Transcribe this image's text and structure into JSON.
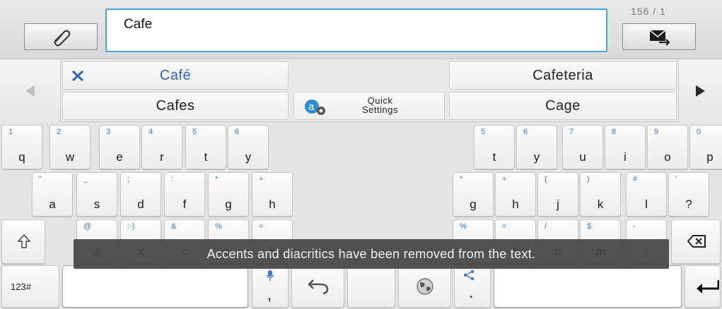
{
  "composer": {
    "text": "Cafe",
    "char_counter": "156 / 1"
  },
  "icons": {
    "attach": "paperclip-icon",
    "send": "send-message-icon",
    "close": "close-icon",
    "quick_settings": "quick-settings-icon",
    "shift": "shift-icon",
    "backspace": "backspace-icon",
    "mic": "microphone-icon",
    "undo": "undo-icon",
    "language": "globe-icon",
    "share": "share-icon",
    "enter": "enter-icon",
    "left": "arrow-left-icon",
    "right": "arrow-right-icon"
  },
  "suggestions": {
    "primary": "Café",
    "secondary": "Cafes",
    "right_top": "Cafeteria",
    "right_bottom": "Cage",
    "quick_settings_line1": "Quick",
    "quick_settings_line2": "Settings"
  },
  "keys": {
    "row1_left": [
      {
        "sec": "1",
        "pri": "q"
      },
      {
        "sec": "2",
        "pri": "w"
      },
      {
        "sec": "3",
        "pri": "e"
      },
      {
        "sec": "4",
        "pri": "r"
      },
      {
        "sec": "5",
        "pri": "t"
      },
      {
        "sec": "6",
        "pri": "y"
      }
    ],
    "row1_right": [
      {
        "sec": "5",
        "pri": "t"
      },
      {
        "sec": "6",
        "pri": "y"
      },
      {
        "sec": "7",
        "pri": "u"
      },
      {
        "sec": "8",
        "pri": "i"
      },
      {
        "sec": "9",
        "pri": "o"
      },
      {
        "sec": "0",
        "pri": "p"
      }
    ],
    "row2_left": [
      {
        "sec": "\"",
        "pri": "a"
      },
      {
        "sec": "_",
        "pri": "s"
      },
      {
        "sec": ";",
        "pri": "d"
      },
      {
        "sec": ":",
        "pri": "f"
      },
      {
        "sec": "*",
        "pri": "g"
      },
      {
        "sec": "+",
        "pri": "h"
      }
    ],
    "row2_right": [
      {
        "sec": "*",
        "pri": "g"
      },
      {
        "sec": "+",
        "pri": "h"
      },
      {
        "sec": "(",
        "pri": "j"
      },
      {
        "sec": ")",
        "pri": "k"
      },
      {
        "sec": "#",
        "pri": "l"
      },
      {
        "sec": "'",
        "pri": "?"
      }
    ],
    "row3_left": [
      {
        "sec": "@",
        "pri": "z"
      },
      {
        "sec": ":-)",
        "pri": "x"
      },
      {
        "sec": "&",
        "pri": "c"
      },
      {
        "sec": "%",
        "pri": "v"
      },
      {
        "sec": "=",
        "pri": "b"
      }
    ],
    "row3_right": [
      {
        "sec": "%",
        "pri": "v"
      },
      {
        "sec": "=",
        "pri": "b"
      },
      {
        "sec": "/",
        "pri": "n"
      },
      {
        "sec": "$",
        "pri": "m"
      },
      {
        "sec": "-",
        "pri": "!"
      }
    ],
    "mode_switch": "123#",
    "comma": ",",
    "period": "."
  },
  "toast": {
    "message": "Accents and diacritics have been removed from the text."
  },
  "colors": {
    "accent": "#3b78c6",
    "toast_bg": "#4a4a4a"
  }
}
